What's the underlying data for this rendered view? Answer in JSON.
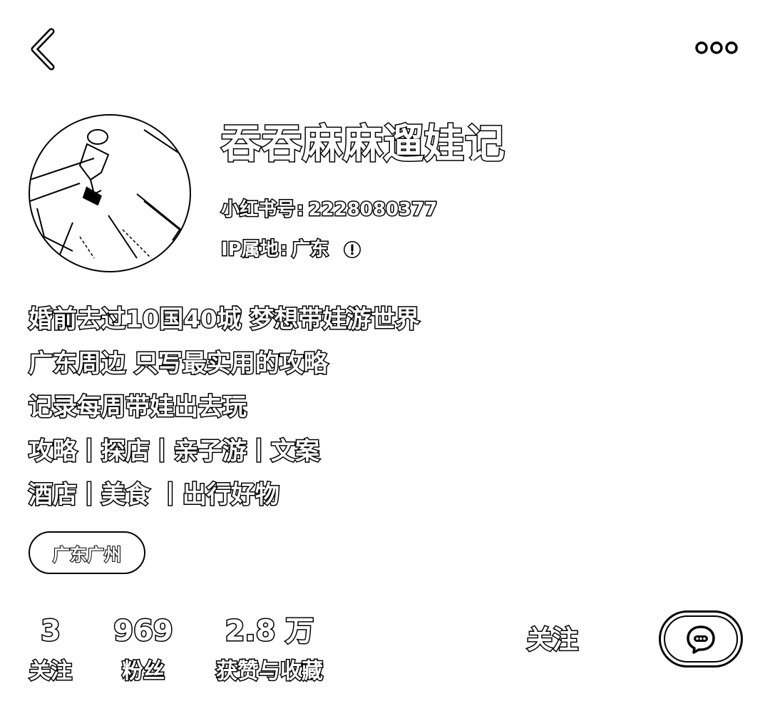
{
  "header": {
    "back_icon": "chevron-left-icon",
    "more_icon": "more-dots-icon"
  },
  "profile": {
    "name": "吞吞麻麻遛娃记",
    "id_label": "小红书号",
    "id_value": "2228080377",
    "ip_label": "IP属地",
    "ip_value": "广东",
    "ip_info_icon": "info-icon",
    "separator": ":"
  },
  "bio": {
    "lines": [
      "婚前去过10国40城 梦想带娃游世界",
      "广东周边 只写最实用的攻略",
      "记录每周带娃出去玩",
      "攻略丨探店丨亲子游丨文案",
      "酒店丨美食 丨出行好物"
    ]
  },
  "location_tag": "广东广州",
  "stats": [
    {
      "value": "3",
      "label": "关注"
    },
    {
      "value": "969",
      "label": "粉丝"
    },
    {
      "value": "2.8 万",
      "label": "获赞与收藏"
    }
  ],
  "actions": {
    "follow_label": "关注",
    "chat_icon": "chat-bubble-icon"
  }
}
